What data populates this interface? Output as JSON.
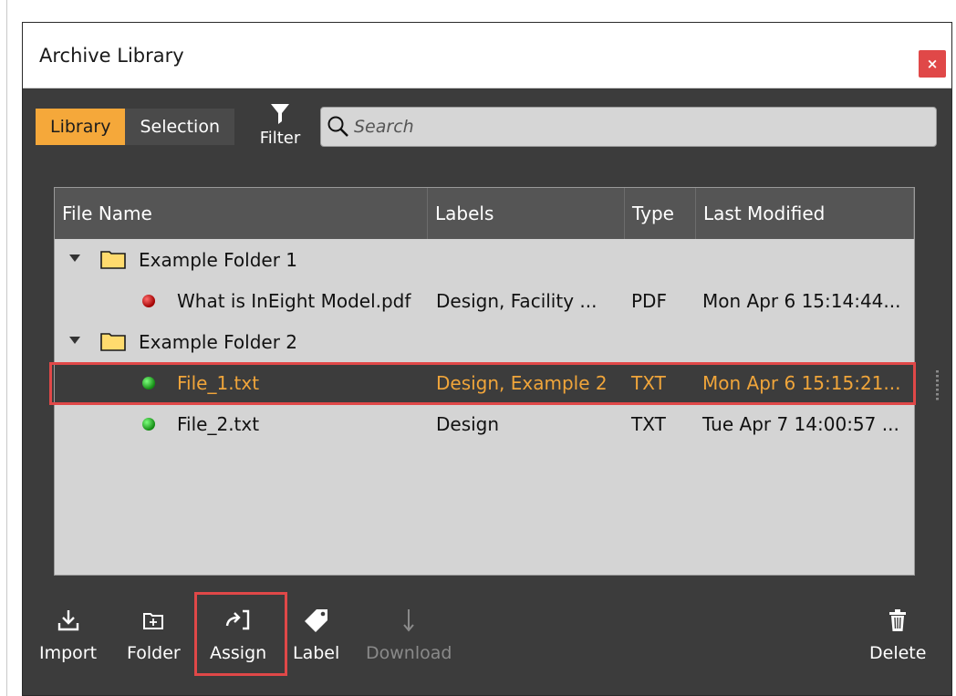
{
  "window": {
    "title": "Archive Library",
    "close_label": "×"
  },
  "tabs": [
    {
      "label": "Library",
      "active": true
    },
    {
      "label": "Selection",
      "active": false
    }
  ],
  "filter": {
    "label": "Filter",
    "icon": "funnel-icon"
  },
  "search": {
    "placeholder": "Search",
    "value": ""
  },
  "table": {
    "columns": [
      "File Name",
      "Labels",
      "Type",
      "Last Modified"
    ],
    "rows": [
      {
        "kind": "folder",
        "name": "Example Folder 1",
        "expanded": true
      },
      {
        "kind": "file",
        "status": "red",
        "name": "What is InEight Model.pdf",
        "labels": "Design, Facility ...",
        "type": "PDF",
        "modified": "Mon Apr 6 15:14:44..."
      },
      {
        "kind": "folder",
        "name": "Example Folder 2",
        "expanded": true
      },
      {
        "kind": "file",
        "status": "green",
        "name": "File_1.txt",
        "labels": "Design, Example 2",
        "type": "TXT",
        "modified": "Mon Apr 6 15:15:21...",
        "selected": true
      },
      {
        "kind": "file",
        "status": "green",
        "name": "File_2.txt",
        "labels": "Design",
        "type": "TXT",
        "modified": "Tue Apr 7 14:00:57 ..."
      }
    ]
  },
  "toolbar": {
    "import_label": "Import",
    "folder_label": "Folder",
    "assign_label": "Assign",
    "label_label": "Label",
    "download_label": "Download",
    "delete_label": "Delete"
  },
  "colors": {
    "accent": "#f5a83a",
    "highlight_red": "#e04848",
    "panel": "#3c3c3c",
    "status_red": "#c00000",
    "status_green": "#1fa31f"
  }
}
